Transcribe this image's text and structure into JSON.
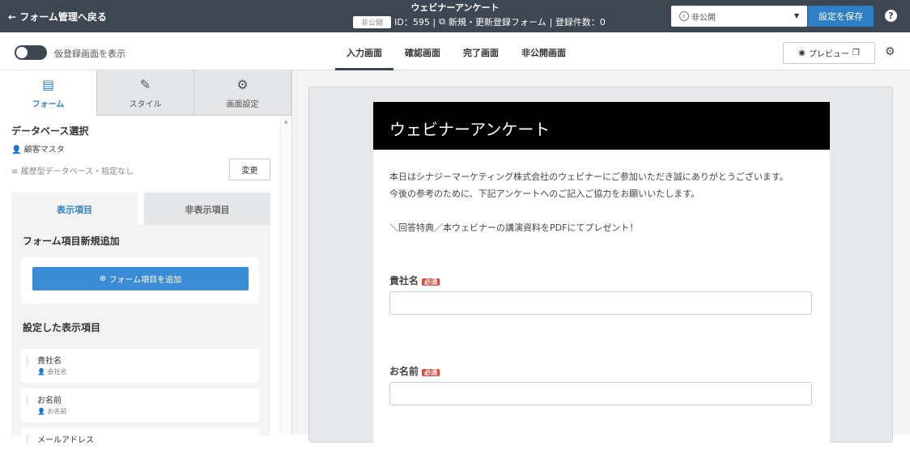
{
  "topbar": {
    "back": "← フォーム管理へ戻る",
    "title": "ウェビナーアンケート",
    "status_badge": "非公開",
    "meta": "ID：595 | ",
    "form_type": "新規・更新登録フォーム",
    "count": "| 登録件数：0",
    "status_select": "非公開",
    "save": "設定を保存",
    "help": "?"
  },
  "subbar": {
    "toggle_label": "仮登録画面を表示",
    "tabs": [
      "入力画面",
      "確認画面",
      "完了画面",
      "非公開画面"
    ],
    "preview": "プレビュー"
  },
  "left": {
    "tabs": [
      {
        "label": "フォーム",
        "icon": "document-icon"
      },
      {
        "label": "スタイル",
        "icon": "magic-wand-icon"
      },
      {
        "label": "画面設定",
        "icon": "gears-icon"
      }
    ],
    "db_title": "データベース選択",
    "db_master": "顧客マスタ",
    "db_hist": "履歴型データベース・指定なし",
    "change": "変更",
    "sub_tabs": [
      "表示項目",
      "非表示項目"
    ],
    "add_title": "フォーム項目新規追加",
    "add_btn": "フォーム項目を追加",
    "set_title": "設定した表示項目",
    "items": [
      {
        "name": "貴社名",
        "sub": "会社名"
      },
      {
        "name": "お名前",
        "sub": "お名前"
      },
      {
        "name": "メールアドレス",
        "sub": ""
      }
    ]
  },
  "form": {
    "header": "ウェビナーアンケート",
    "intro1": "本日はシナジーマーケティング株式会社のウェビナーにご参加いただき誠にありがとうございます。",
    "intro2": "今後の参考のために、下記アンケートへのご記入ご協力をお願いいたします。",
    "intro3": "＼回答特典／本ウェビナーの講演資料をPDFにてプレゼント！",
    "fields": [
      {
        "label": "貴社名",
        "required": "必須"
      },
      {
        "label": "お名前",
        "required": "必須"
      }
    ]
  }
}
